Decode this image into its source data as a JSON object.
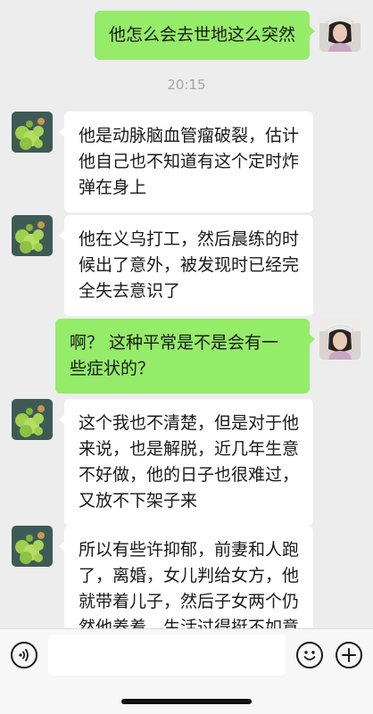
{
  "messages": [
    {
      "sender": "self",
      "text": "他怎么会去世地这么突然"
    },
    {
      "type": "timestamp",
      "text": "20:15"
    },
    {
      "sender": "contact",
      "text": "他是动脉脑血管瘤破裂，估计他自己也不知道有这个定时炸弹在身上"
    },
    {
      "sender": "contact",
      "text": "他在义乌打工，然后晨练的时候出了意外，被发现时已经完全失去意识了"
    },
    {
      "sender": "self",
      "text": "啊？ 这种平常是不是会有一些症状的？"
    },
    {
      "sender": "contact",
      "text": "这个我也不清楚，但是对于他来说，也是解脱，近几年生意不好做，他的日子也很难过，又放不下架子来"
    },
    {
      "sender": "contact",
      "text": "所以有些许抑郁，前妻和人跑了，离婚，女儿判给女方，他就带着儿子，然后子女两个仍然他养着，生活过得挺不如意"
    }
  ],
  "input_bar": {
    "placeholder": "",
    "voice_icon": "voice-icon",
    "emoji_icon": "emoji-icon",
    "plus_icon": "plus-icon"
  },
  "colors": {
    "background": "#ededed",
    "bubble_self": "#95ec69",
    "bubble_contact": "#ffffff",
    "timestamp": "#a4a4a4"
  }
}
